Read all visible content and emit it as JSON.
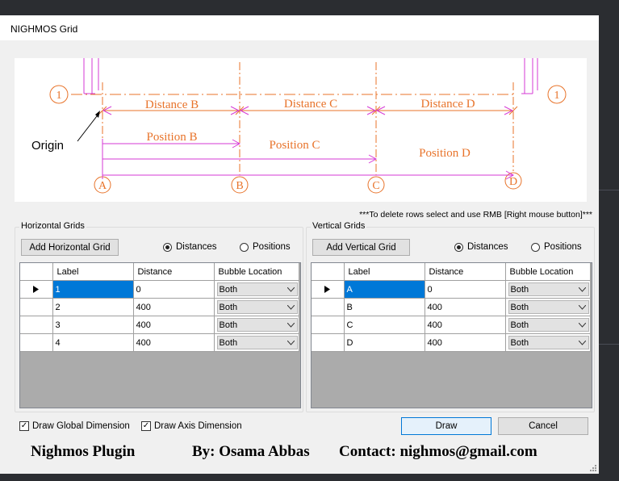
{
  "window": {
    "title": "NIGHMOS Grid"
  },
  "diagram": {
    "origin_label": "Origin",
    "bubbles_h": [
      "1",
      "1"
    ],
    "bubbles_v": [
      "A",
      "B",
      "C",
      "D"
    ],
    "distances": [
      "Distance B",
      "Distance C",
      "Distance D"
    ],
    "positions": [
      "Position B",
      "Position C",
      "Position D"
    ],
    "colors": {
      "dimension": "#e8732a",
      "position": "#d63ad6"
    }
  },
  "note": "***To delete rows select and use RMB [Right mouse button]***",
  "horizontal": {
    "group_label": "Horizontal Grids",
    "add_button": "Add Horizontal Grid",
    "radio_distances": "Distances",
    "radio_positions": "Positions",
    "columns": [
      "Label",
      "Distance",
      "Bubble Location"
    ],
    "rows": [
      {
        "label": "1",
        "distance": "0",
        "bubble": "Both"
      },
      {
        "label": "2",
        "distance": "400",
        "bubble": "Both"
      },
      {
        "label": "3",
        "distance": "400",
        "bubble": "Both"
      },
      {
        "label": "4",
        "distance": "400",
        "bubble": "Both"
      }
    ]
  },
  "vertical": {
    "group_label": "Vertical Grids",
    "add_button": "Add Vertical Grid",
    "radio_distances": "Distances",
    "radio_positions": "Positions",
    "columns": [
      "Label",
      "Distance",
      "Bubble Location"
    ],
    "rows": [
      {
        "label": "A",
        "distance": "0",
        "bubble": "Both"
      },
      {
        "label": "B",
        "distance": "400",
        "bubble": "Both"
      },
      {
        "label": "C",
        "distance": "400",
        "bubble": "Both"
      },
      {
        "label": "D",
        "distance": "400",
        "bubble": "Both"
      }
    ]
  },
  "options": {
    "draw_global_dimension": "Draw Global Dimension",
    "draw_axis_dimension": "Draw Axis Dimension"
  },
  "buttons": {
    "draw": "Draw",
    "cancel": "Cancel"
  },
  "footer": {
    "plugin": "Nighmos Plugin",
    "author": "By: Osama Abbas",
    "contact": "Contact:  nighmos@gmail.com"
  }
}
